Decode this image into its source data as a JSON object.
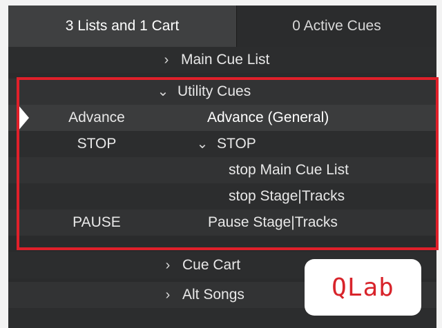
{
  "tabs": {
    "active_label": "3 Lists and 1 Cart",
    "inactive_label": "0 Active Cues"
  },
  "rows": [
    {
      "number": "",
      "name": "Main Cue List",
      "chevron": "›",
      "type": "cue-list"
    },
    {
      "number": "",
      "name": "Utility Cues",
      "chevron": "⌄",
      "type": "cue-list"
    },
    {
      "number": "Advance",
      "name": "Advance (General)",
      "chevron": "",
      "type": "cue"
    },
    {
      "number": "STOP",
      "name": "STOP",
      "chevron": "⌄",
      "type": "group-cue"
    },
    {
      "number": "",
      "name": "stop Main Cue List",
      "chevron": "",
      "type": "cue"
    },
    {
      "number": "",
      "name": "stop Stage|Tracks",
      "chevron": "",
      "type": "cue"
    },
    {
      "number": "PAUSE",
      "name": "Pause Stage|Tracks",
      "chevron": "",
      "type": "cue"
    },
    {
      "number": "",
      "name": "Cue Cart",
      "chevron": "›",
      "type": "cue-list"
    },
    {
      "number": "",
      "name": "Alt Songs",
      "chevron": "›",
      "type": "cue-list"
    }
  ],
  "badge": {
    "label": "QLab"
  },
  "colors": {
    "highlight": "#e0202a",
    "panel_bg": "#2a2b2c",
    "badge_text": "#d8242b"
  },
  "icons": {
    "playhead": "playhead-triangle-icon",
    "collapsed": "chevron-right-icon",
    "expanded": "chevron-down-icon"
  }
}
